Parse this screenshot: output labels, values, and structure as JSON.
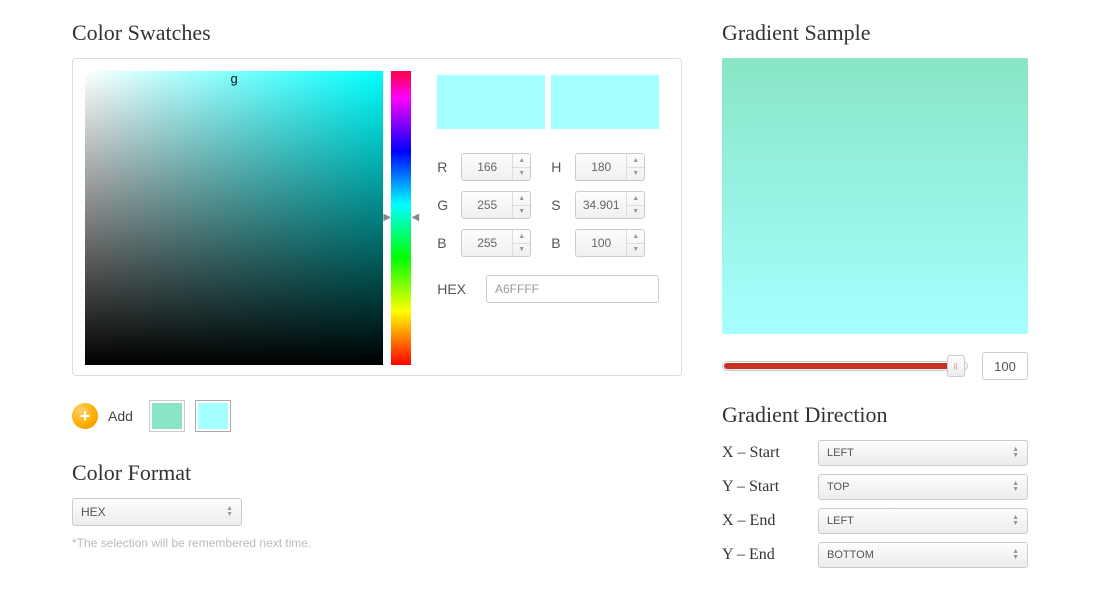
{
  "headings": {
    "swatches": "Color Swatches",
    "format": "Color Format",
    "gradient_sample": "Gradient Sample",
    "gradient_direction": "Gradient Direction"
  },
  "picker": {
    "sv_label": "g",
    "preview_color": "#A6FFFF",
    "rgb": {
      "r_label": "R",
      "g_label": "G",
      "b_label": "B",
      "r": "166",
      "g": "255",
      "b": "255"
    },
    "hsb": {
      "h_label": "H",
      "s_label": "S",
      "b_label": "B",
      "h": "180",
      "s": "34.901",
      "b": "100"
    },
    "hex_label": "HEX",
    "hex": "A6FFFF"
  },
  "swatches": {
    "add_label": "Add",
    "items": [
      {
        "color": "#89E5C6",
        "selected": false
      },
      {
        "color": "#A6FFFF",
        "selected": true
      }
    ]
  },
  "format": {
    "selected": "HEX",
    "hint": "*The selection will be remembered next time."
  },
  "gradient": {
    "from": "#89E5C6",
    "to": "#A6FFFF",
    "slider_value": "100"
  },
  "direction": {
    "x_start_label": "X – Start",
    "y_start_label": "Y – Start",
    "x_end_label": "X – End",
    "y_end_label": "Y – End",
    "x_start": "LEFT",
    "y_start": "TOP",
    "x_end": "LEFT",
    "y_end": "BOTTOM"
  }
}
